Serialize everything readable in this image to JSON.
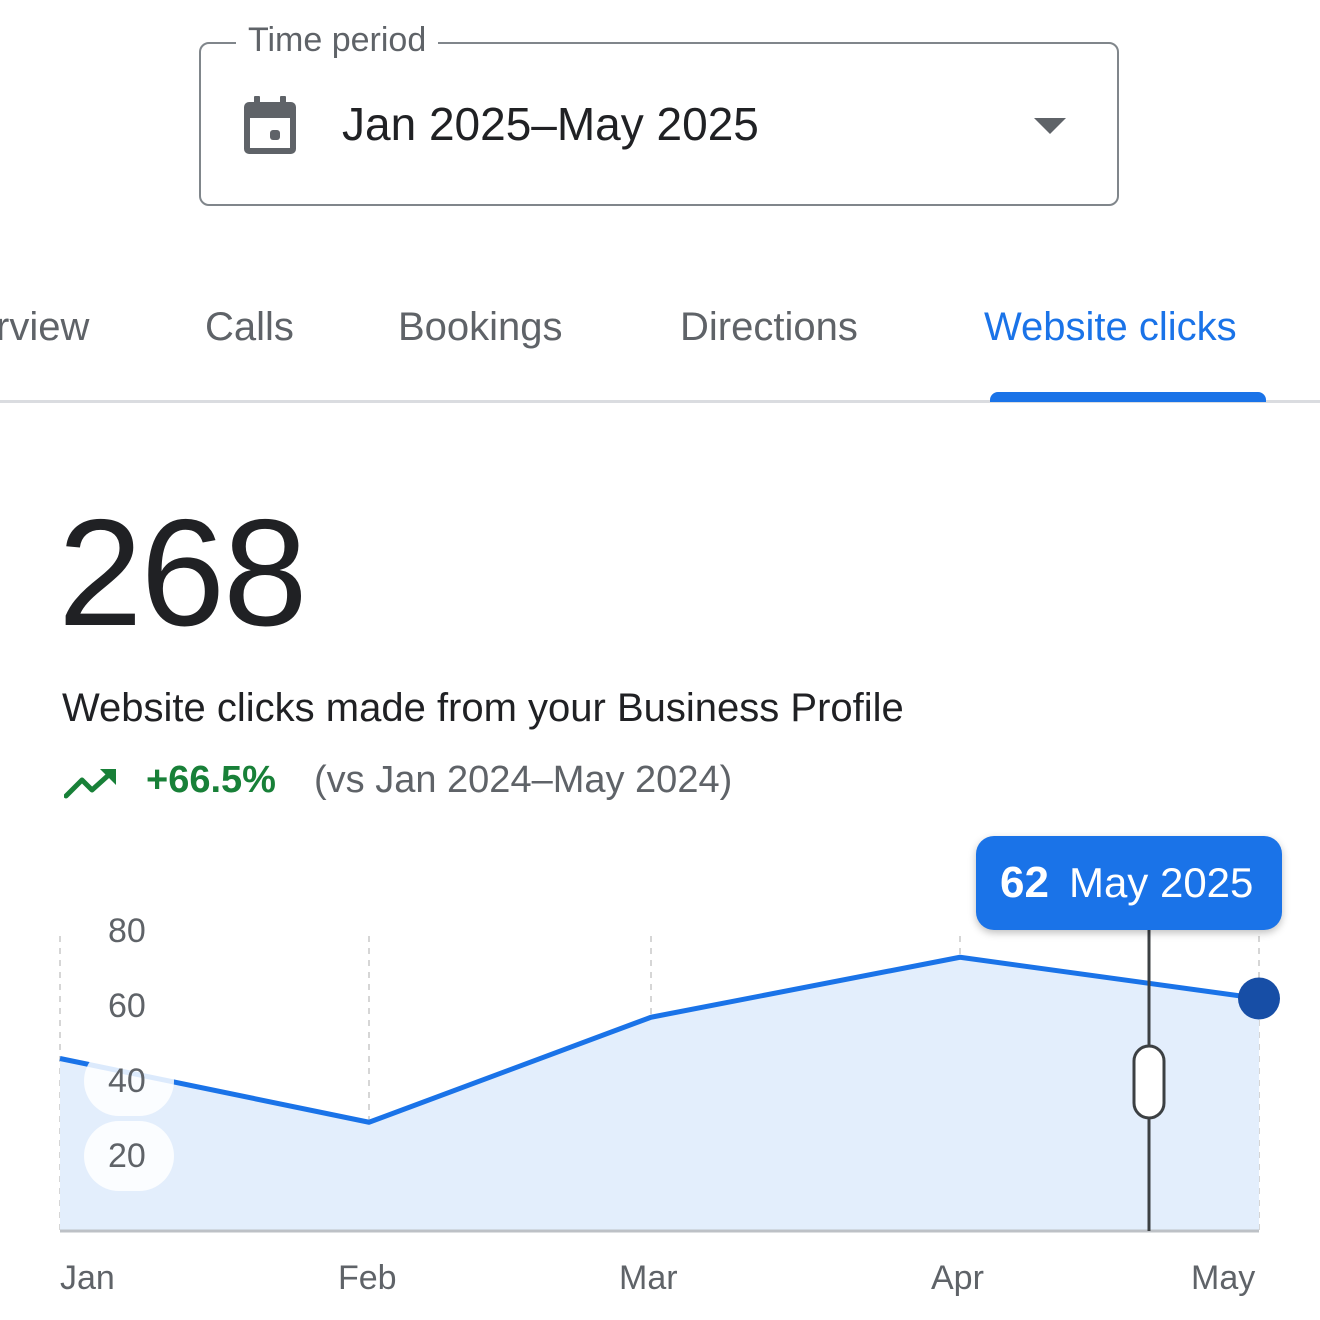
{
  "time_period": {
    "label": "Time period",
    "value": "Jan 2025–May 2025",
    "icon": "calendar-icon"
  },
  "tabs": [
    {
      "label": "rview",
      "active": false
    },
    {
      "label": "Calls",
      "active": false
    },
    {
      "label": "Bookings",
      "active": false
    },
    {
      "label": "Directions",
      "active": false
    },
    {
      "label": "Website clicks",
      "active": true
    }
  ],
  "metric": {
    "value": "268",
    "description": "Website clicks made from your Business Profile",
    "change": "+66.5%",
    "comparison": "(vs Jan 2024–May 2024)",
    "change_color": "#188038"
  },
  "colors": {
    "accent": "#1a73e8",
    "line": "#1a73e8",
    "area": "#e3eefc",
    "marker": "#174ea6"
  },
  "tooltip": {
    "value": "62",
    "date": "May 2025"
  },
  "chart_data": {
    "type": "area",
    "categories": [
      "Jan",
      "Feb",
      "Mar",
      "Apr",
      "May"
    ],
    "values": [
      46,
      29,
      57,
      73,
      62
    ],
    "y_ticks": [
      "80",
      "60",
      "40",
      "20"
    ],
    "ylim": [
      0,
      80
    ],
    "grid": "vertical-dashed",
    "highlighted_index": 4
  }
}
